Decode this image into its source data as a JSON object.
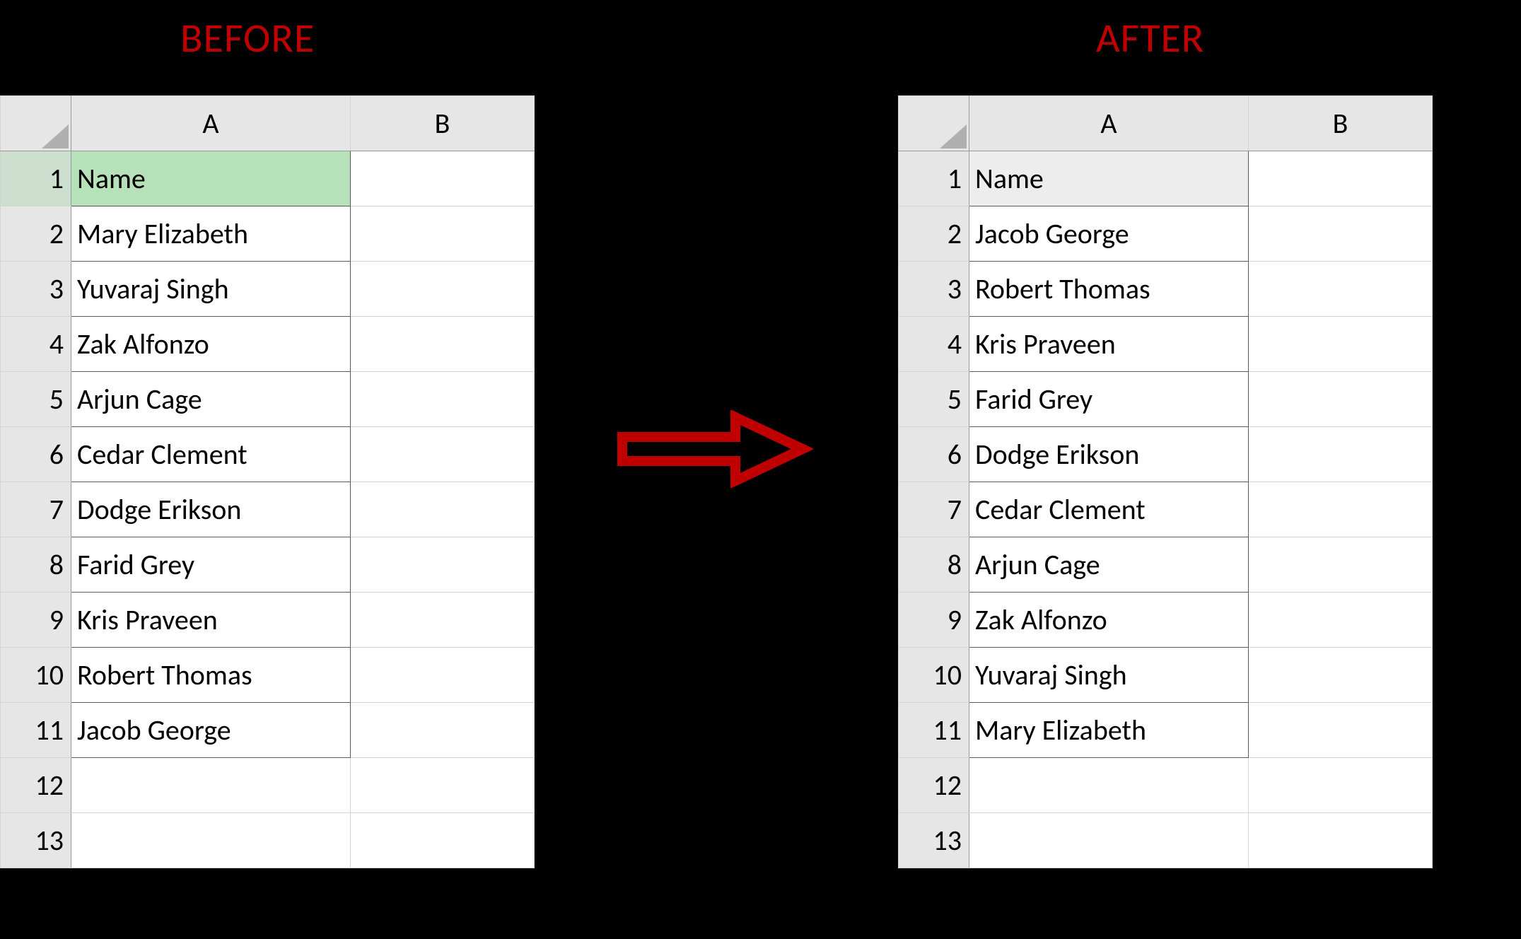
{
  "labels": {
    "before": "BEFORE",
    "after": "AFTER"
  },
  "columns": [
    "A",
    "B"
  ],
  "row_numbers": [
    "1",
    "2",
    "3",
    "4",
    "5",
    "6",
    "7",
    "8",
    "9",
    "10",
    "11",
    "12",
    "13"
  ],
  "before": {
    "header": "Name",
    "rows": [
      "Mary Elizabeth",
      "Yuvaraj Singh",
      "Zak Alfonzo",
      "Arjun Cage",
      "Cedar Clement",
      "Dodge Erikson",
      "Farid Grey",
      "Kris Praveen",
      "Robert Thomas",
      "Jacob George"
    ],
    "active_cell_row": 1
  },
  "after": {
    "header": "Name",
    "rows": [
      "Jacob George",
      "Robert Thomas",
      "Kris Praveen",
      "Farid Grey",
      "Dodge Erikson",
      "Cedar Clement",
      "Arjun Cage",
      "Zak Alfonzo",
      "Yuvaraj Singh",
      "Mary Elizabeth"
    ]
  }
}
